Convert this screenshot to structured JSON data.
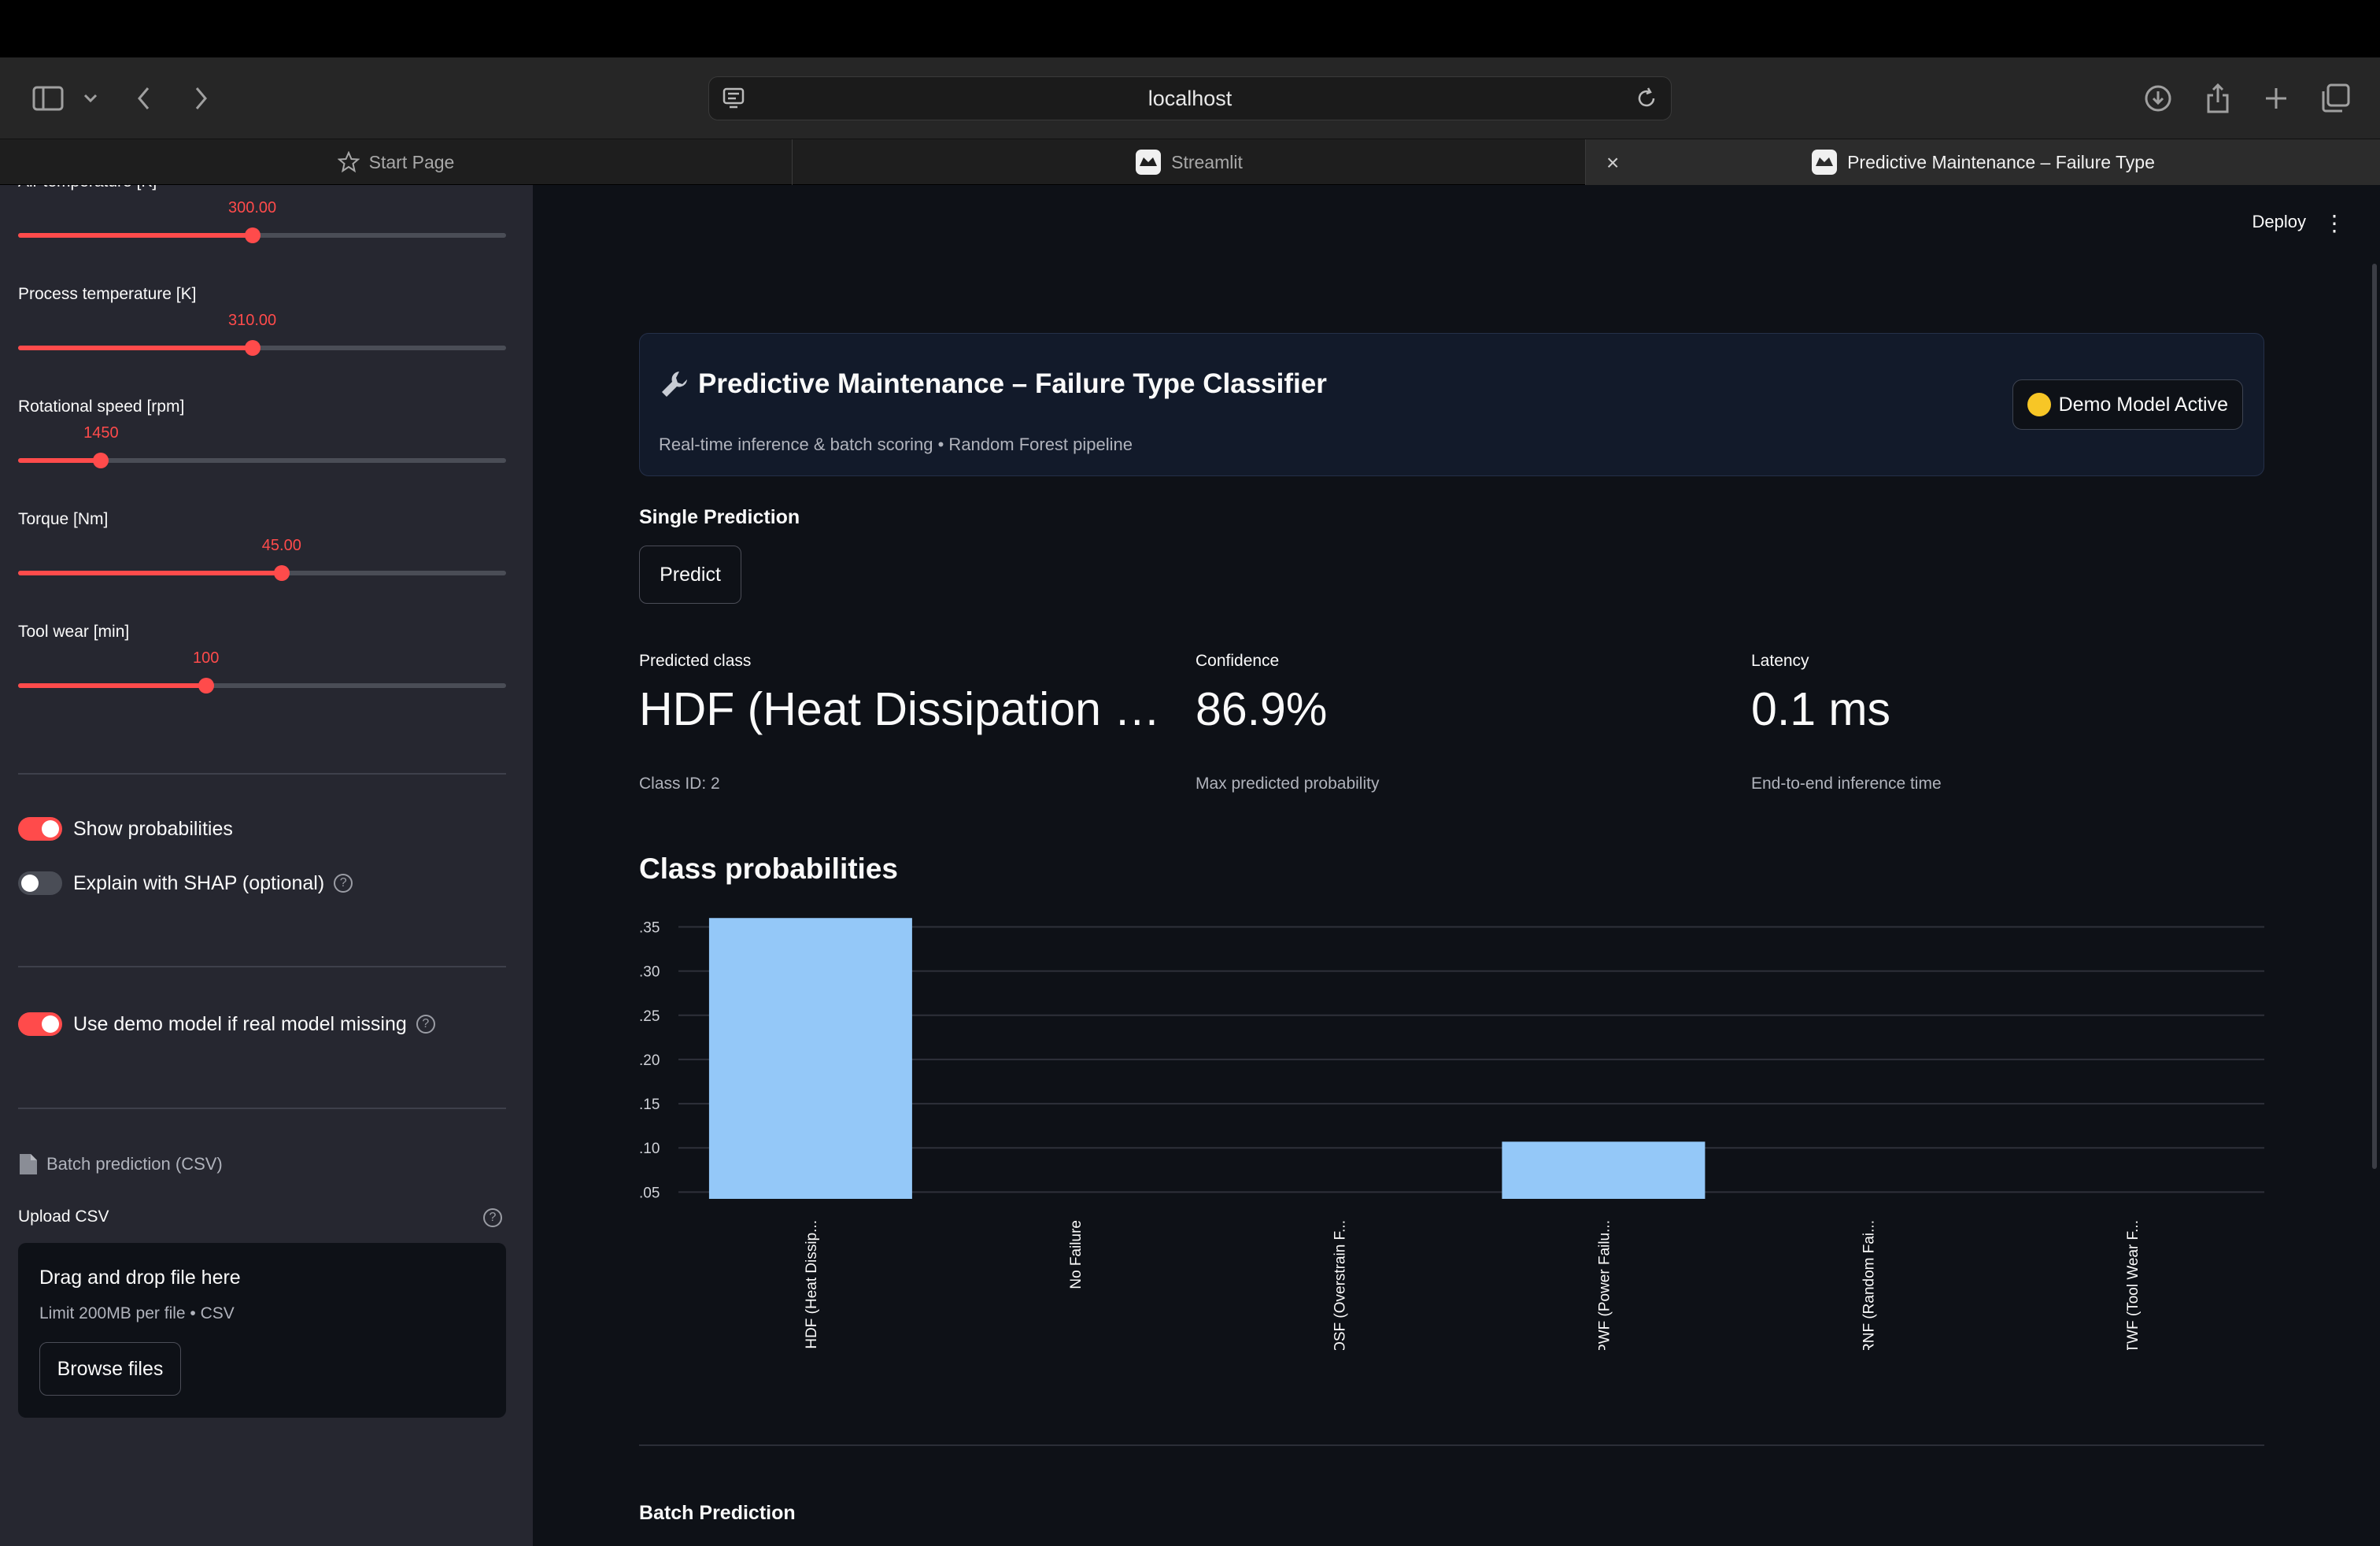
{
  "browser": {
    "url": "localhost",
    "tabs": [
      {
        "label": "Start Page"
      },
      {
        "label": "Streamlit"
      },
      {
        "label": "Predictive Maintenance – Failure Type"
      }
    ]
  },
  "sidebar": {
    "sliders": [
      {
        "label": "Air temperature [K]",
        "value": "300.00",
        "fraction": 0.48
      },
      {
        "label": "Process temperature [K]",
        "value": "310.00",
        "fraction": 0.48
      },
      {
        "label": "Rotational speed [rpm]",
        "value": "1450",
        "fraction": 0.17
      },
      {
        "label": "Torque [Nm]",
        "value": "45.00",
        "fraction": 0.54
      },
      {
        "label": "Tool wear [min]",
        "value": "100",
        "fraction": 0.385
      }
    ],
    "toggles": {
      "show_probabilities": {
        "label": "Show probabilities",
        "on": true
      },
      "explain_shap": {
        "label": "Explain with SHAP (optional)",
        "on": false
      },
      "use_demo": {
        "label": "Use demo model if real model missing",
        "on": true
      }
    },
    "batch_header": "Batch prediction (CSV)",
    "upload": {
      "label": "Upload CSV",
      "drop_text": "Drag and drop file here",
      "limit": "Limit 200MB per file • CSV",
      "browse": "Browse files"
    }
  },
  "main": {
    "deploy": "Deploy",
    "header": {
      "title": "Predictive Maintenance – Failure Type Classifier",
      "subtitle": "Real-time inference & batch scoring • Random Forest pipeline",
      "badge": "Demo Model Active"
    },
    "single_prediction": "Single Prediction",
    "predict_button": "Predict",
    "metrics": [
      {
        "label": "Predicted class",
        "value": "HDF (Heat Dissipation …",
        "delta": "Class ID: 2"
      },
      {
        "label": "Confidence",
        "value": "86.9%",
        "delta": "Max predicted probability"
      },
      {
        "label": "Latency",
        "value": "0.1 ms",
        "delta": "End-to-end inference time"
      }
    ],
    "chart_title": "Class probabilities",
    "batch_title": "Batch Prediction"
  },
  "chart_data": {
    "type": "bar",
    "title": "Class probabilities",
    "categories": [
      "HDF (Heat Dissip...",
      "No Failure",
      "OSF (Overstrain F...",
      "PWF (Power Failu...",
      "RNF (Random Fai...",
      "TWF (Tool Wear F..."
    ],
    "values": [
      0.36,
      0.0,
      0.0,
      0.107,
      0.0,
      0.0
    ],
    "y_ticks": [
      ".05",
      ".10",
      ".15",
      ".20",
      ".25",
      ".30",
      ".35"
    ],
    "ylim": [
      0.045,
      0.37
    ],
    "color": "#94c8f8",
    "grid": true
  }
}
